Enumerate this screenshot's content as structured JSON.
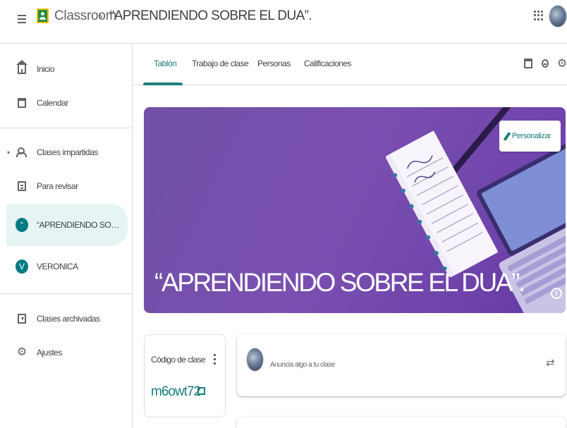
{
  "topbar": {
    "app_name": "Classroom",
    "separator": "›",
    "class_name": "“APRENDIENDO SOBRE EL DUA”.",
    "menu_icon": "hamburger-menu-icon",
    "apps_icon": "google-apps-icon",
    "account_icon": "account-avatar"
  },
  "sidebar": {
    "items": [
      {
        "label": "Inicio",
        "icon": "home-icon"
      },
      {
        "label": "Calendar",
        "icon": "calendar-icon"
      },
      {
        "label": "Clases impartidas",
        "icon": "people-icon"
      },
      {
        "label": "Para revisar",
        "icon": "review-icon"
      },
      {
        "label": "“APRENDIENDO SOBRE EL D...",
        "avatar_letter": "“",
        "active": true
      },
      {
        "label": "VERONICA",
        "avatar_letter": "V"
      },
      {
        "label": "Clases archivadas",
        "icon": "archive-icon"
      },
      {
        "label": "Ajustes",
        "icon": "gear-icon"
      }
    ],
    "caret": "▾"
  },
  "tabs": {
    "items": [
      "Tablón",
      "Trabajo de clase",
      "Personas",
      "Calificaciones"
    ],
    "active": "Tablón"
  },
  "banner": {
    "title": "“APRENDIENDO SOBRE EL DUA”.",
    "customize_label": "Personalizar",
    "info_icon_text": "i",
    "background_color": "#7050a8"
  },
  "class_code": {
    "label": "Código de clase",
    "value": "m6owt72"
  },
  "announce": {
    "placeholder": "Anuncia algo a tu clase",
    "repost_icon": "⇄"
  },
  "colors": {
    "accent": "#1a7f7a",
    "active_nav_bg": "#e6f4f4",
    "class_avatar": "#007b83"
  }
}
